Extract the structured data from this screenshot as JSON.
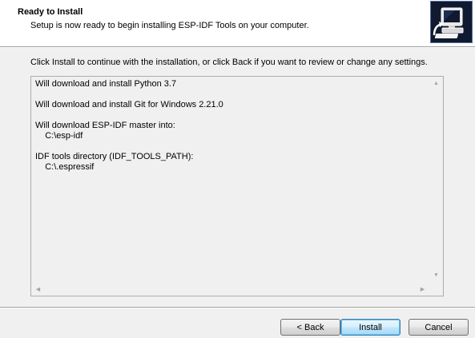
{
  "header": {
    "title": "Ready to Install",
    "subtitle": "Setup is now ready to begin installing ESP-IDF Tools on your computer."
  },
  "instruction": "Click Install to continue with the installation, or click Back if you want to review or change any settings.",
  "memo": {
    "download_python": "Will download and install Python 3.7",
    "download_git": "Will download and install Git for Windows 2.21.0",
    "download_espidf": "Will download ESP-IDF master into:",
    "espidf_path": "    C:\\esp-idf",
    "tools_dir_label": "IDF tools directory (IDF_TOOLS_PATH):",
    "tools_dir_path": "    C:\\.espressif"
  },
  "buttons": {
    "back": "< Back",
    "install": "Install",
    "cancel": "Cancel"
  },
  "colors": {
    "window_bg": "#f0f0f0",
    "header_bg": "#ffffff",
    "install_button_accent": "#3c7fb1"
  },
  "icons": {
    "wizard": "installer-computer-icon",
    "scroll_up": "scroll-up-arrow-icon",
    "scroll_down": "scroll-down-arrow-icon",
    "scroll_left": "scroll-left-arrow-icon",
    "scroll_right": "scroll-right-arrow-icon"
  }
}
